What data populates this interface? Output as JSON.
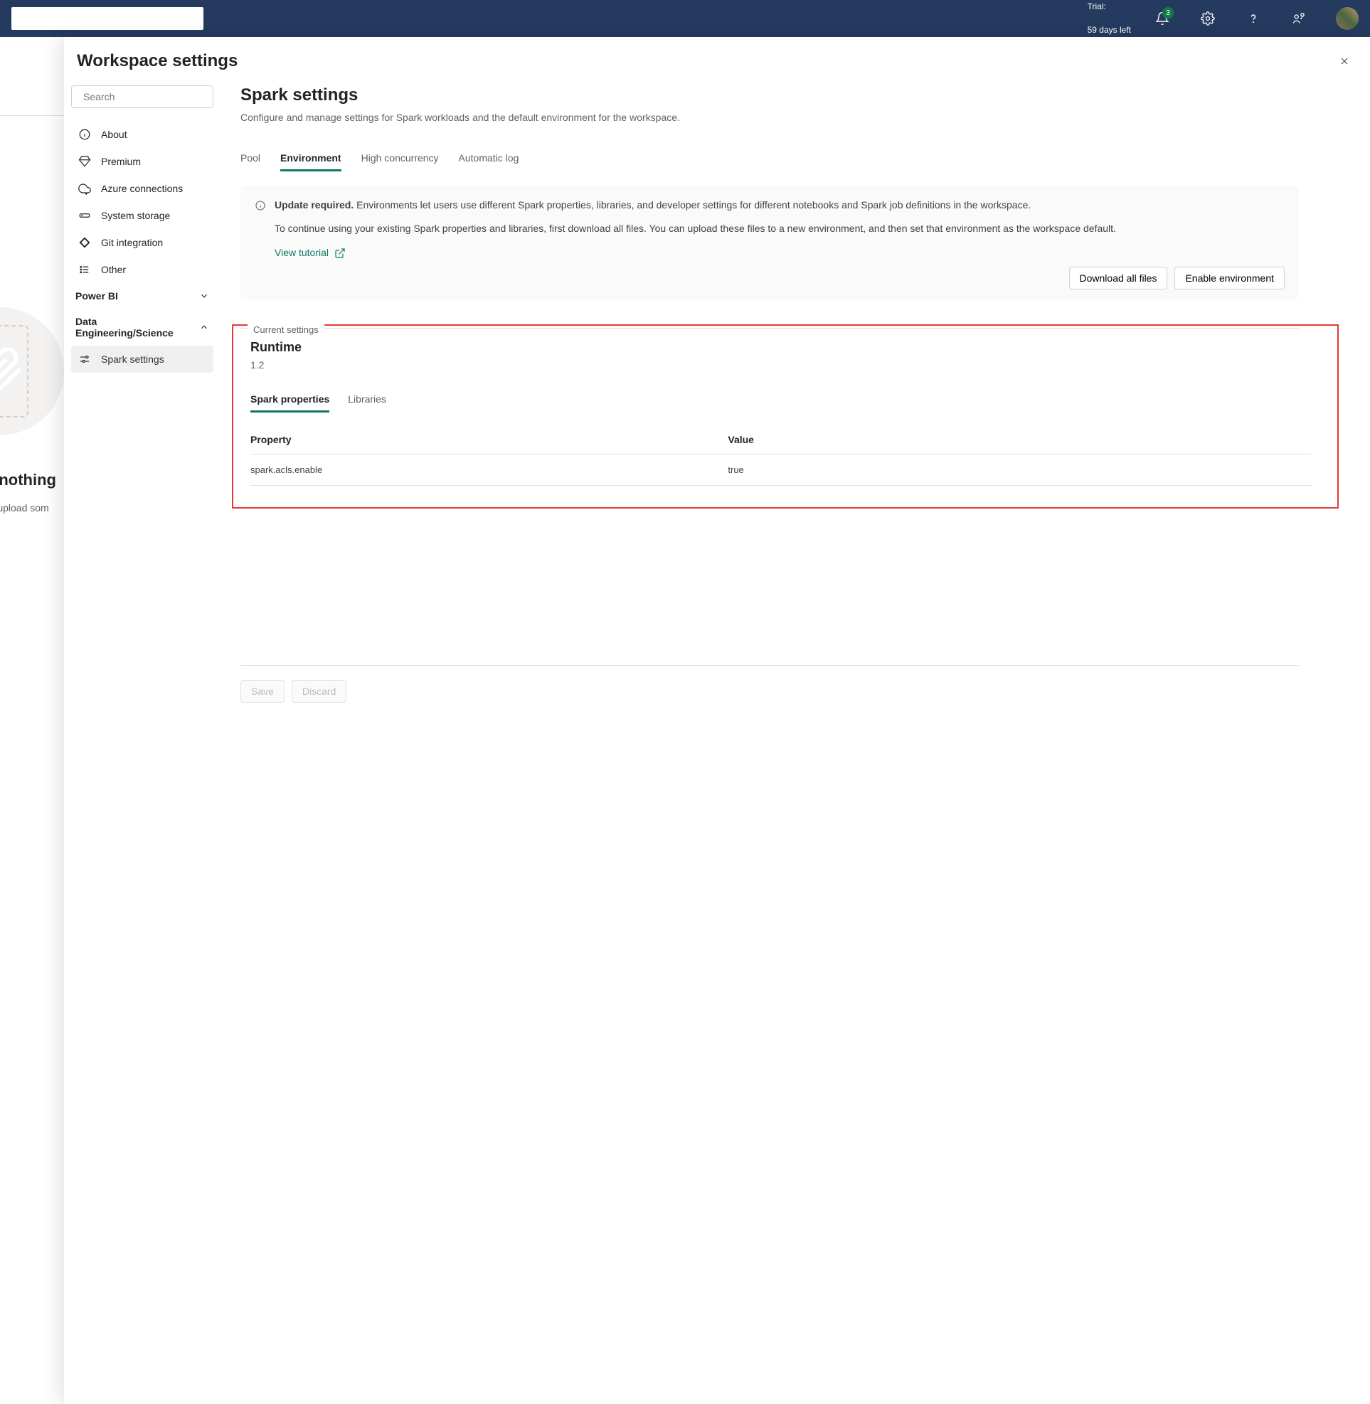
{
  "header": {
    "trial_line1": "Trial:",
    "trial_line2": "59 days left",
    "notification_badge": "3"
  },
  "bg": {
    "main": "s nothing",
    "sub": "or upload som"
  },
  "panel": {
    "title": "Workspace settings",
    "search_placeholder": "Search"
  },
  "sidebar": {
    "items": [
      {
        "label": "About"
      },
      {
        "label": "Premium"
      },
      {
        "label": "Azure connections"
      },
      {
        "label": "System storage"
      },
      {
        "label": "Git integration"
      },
      {
        "label": "Other"
      }
    ],
    "section_powerbi": "Power BI",
    "section_data": "Data Engineering/Science",
    "spark_settings": "Spark settings"
  },
  "content": {
    "title": "Spark settings",
    "subtitle": "Configure and manage settings for Spark workloads and the default environment for the workspace.",
    "tabs": [
      "Pool",
      "Environment",
      "High concurrency",
      "Automatic log"
    ],
    "info": {
      "title": "Update required.",
      "body1": "Environments let users use different Spark properties, libraries, and developer settings for different notebooks and Spark job definitions in the workspace.",
      "body2": "To continue using your existing Spark properties and libraries, first download all files. You can upload these files to a new environment, and then set that environment as the workspace default.",
      "tutorial": "View tutorial",
      "download": "Download all files",
      "enable": "Enable environment"
    },
    "current_settings": "Current settings",
    "runtime_title": "Runtime",
    "runtime_version": "1.2",
    "sub_tabs": [
      "Spark properties",
      "Libraries"
    ],
    "table": {
      "col_property": "Property",
      "col_value": "Value",
      "rows": [
        {
          "property": "spark.acls.enable",
          "value": "true"
        }
      ]
    },
    "footer": {
      "save": "Save",
      "discard": "Discard"
    }
  }
}
